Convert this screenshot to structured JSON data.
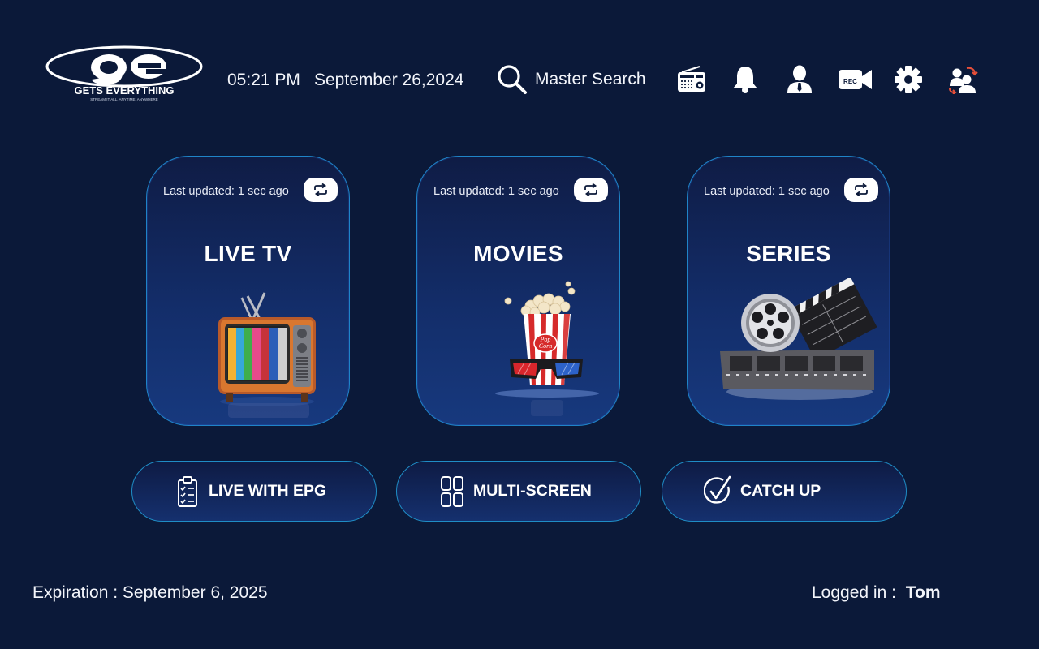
{
  "header": {
    "logo_text": "GETS EVERYTHING",
    "logo_tagline": "STREAM IT ALL, ANYTIME, ANYWHERE",
    "time": "05:21 PM",
    "date": "September 26,2024",
    "search_label": "Master Search",
    "icons": [
      "radio-icon",
      "bell-icon",
      "user-icon",
      "record-icon",
      "settings-icon",
      "switch-user-icon"
    ]
  },
  "cards": [
    {
      "title": "LIVE TV",
      "updated": "Last updated: 1 sec ago",
      "art": "retro-tv"
    },
    {
      "title": "MOVIES",
      "updated": "Last updated: 1 sec ago",
      "art": "popcorn-3d-glasses"
    },
    {
      "title": "SERIES",
      "updated": "Last updated: 1 sec ago",
      "art": "film-reel-clapperboard"
    }
  ],
  "features": [
    {
      "label": "LIVE WITH EPG",
      "icon": "clipboard-checklist-icon"
    },
    {
      "label": "MULTI-SCREEN",
      "icon": "grid-icon"
    },
    {
      "label": "CATCH UP",
      "icon": "check-circle-icon"
    }
  ],
  "footer": {
    "expiration": "Expiration : September 6, 2025",
    "logged_in_label": "Logged in :",
    "username": "Tom"
  },
  "colors": {
    "background": "#0b1939",
    "card_border": "#1f84c8",
    "card_gradient_bottom": "#17397e",
    "text": "#ffffff"
  }
}
